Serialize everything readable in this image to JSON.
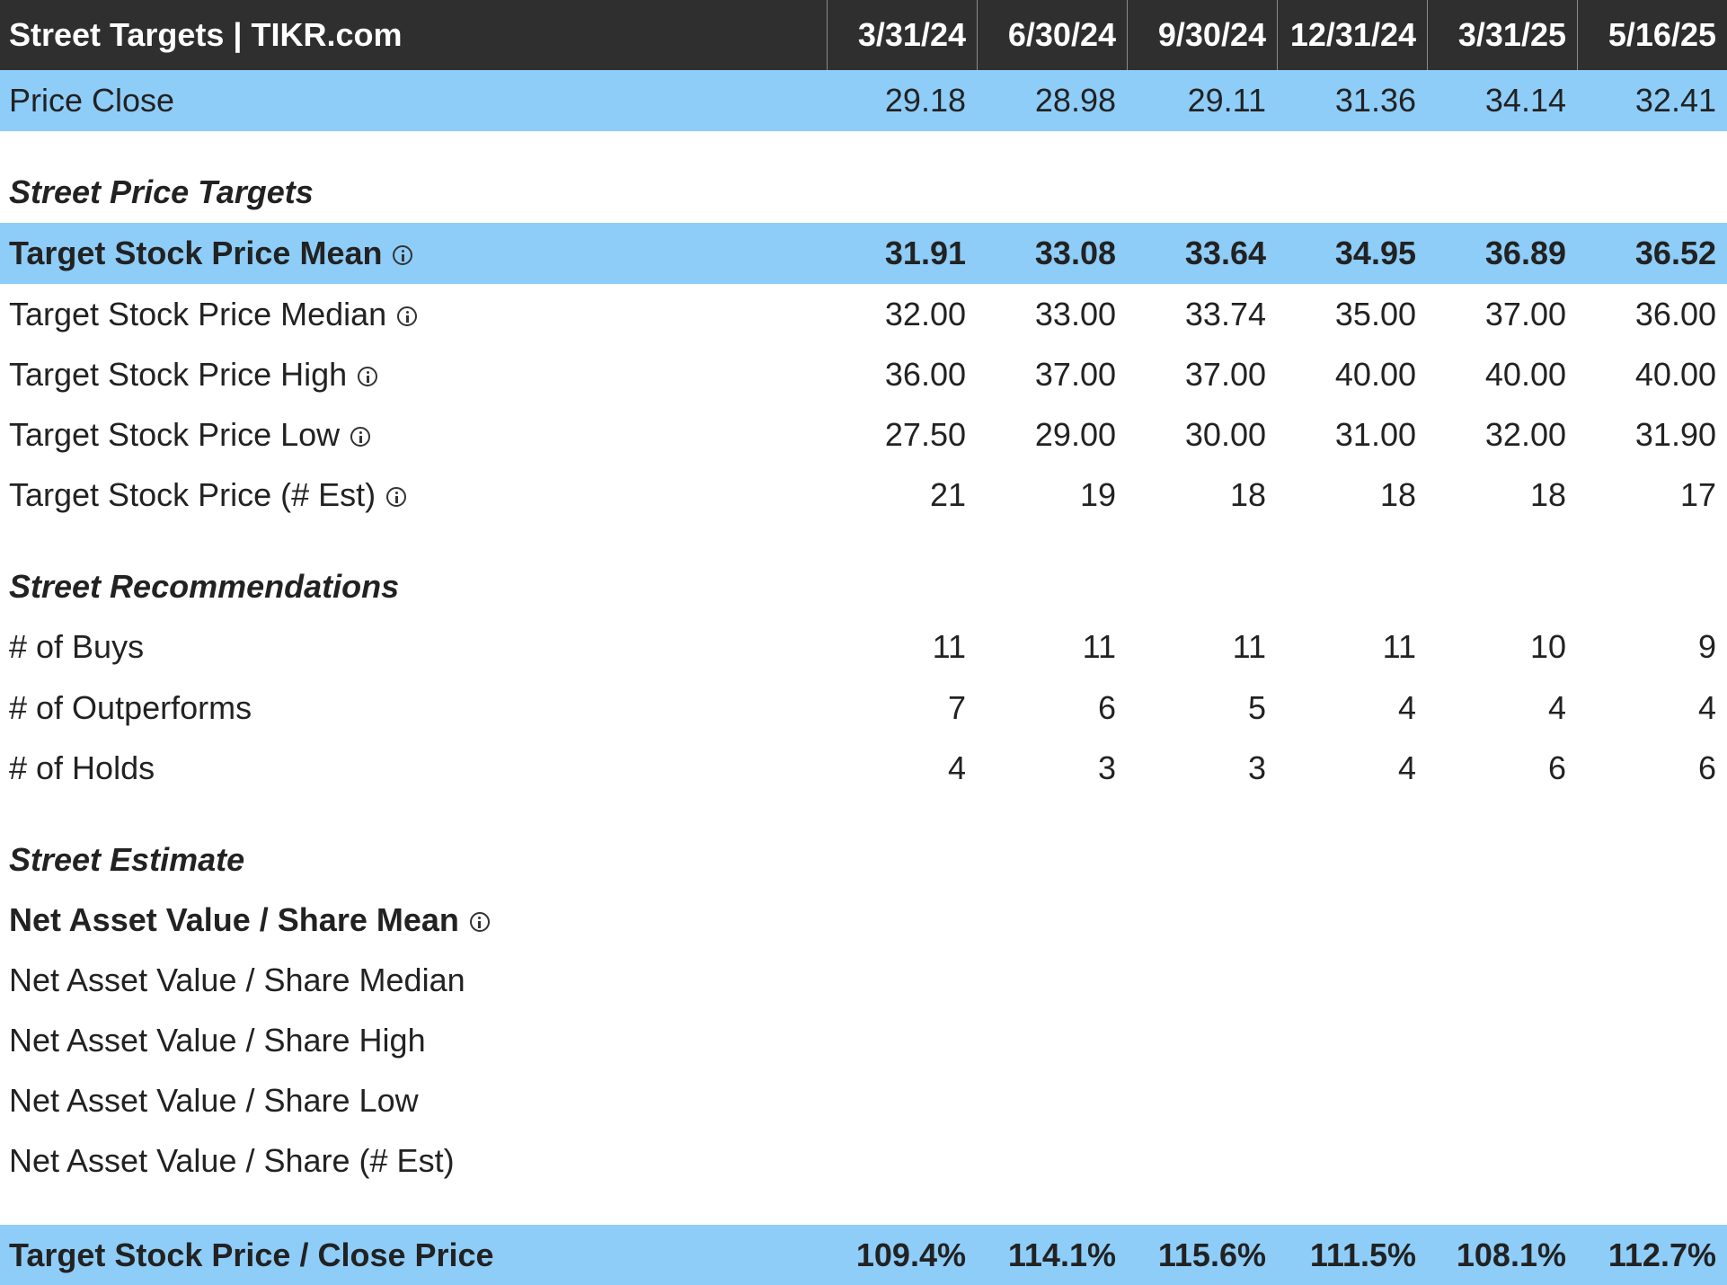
{
  "header": {
    "title": "Street Targets | TIKR.com",
    "dates": [
      "3/31/24",
      "6/30/24",
      "9/30/24",
      "12/31/24",
      "3/31/25",
      "5/16/25"
    ]
  },
  "price_close": {
    "label": "Price Close",
    "values": [
      "29.18",
      "28.98",
      "29.11",
      "31.36",
      "34.14",
      "32.41"
    ]
  },
  "sections": {
    "price_targets": "Street Price Targets",
    "recommendations": "Street Recommendations",
    "estimate": "Street Estimate"
  },
  "target_mean": {
    "label": "Target Stock Price Mean",
    "values": [
      "31.91",
      "33.08",
      "33.64",
      "34.95",
      "36.89",
      "36.52"
    ]
  },
  "target_median": {
    "label": "Target Stock Price Median",
    "values": [
      "32.00",
      "33.00",
      "33.74",
      "35.00",
      "37.00",
      "36.00"
    ]
  },
  "target_high": {
    "label": "Target Stock Price High",
    "values": [
      "36.00",
      "37.00",
      "37.00",
      "40.00",
      "40.00",
      "40.00"
    ]
  },
  "target_low": {
    "label": "Target Stock Price Low",
    "values": [
      "27.50",
      "29.00",
      "30.00",
      "31.00",
      "32.00",
      "31.90"
    ]
  },
  "target_est": {
    "label": "Target Stock Price (# Est)",
    "values": [
      "21",
      "19",
      "18",
      "18",
      "18",
      "17"
    ]
  },
  "buys": {
    "label": "# of Buys",
    "values": [
      "11",
      "11",
      "11",
      "11",
      "10",
      "9"
    ]
  },
  "outperforms": {
    "label": "# of Outperforms",
    "values": [
      "7",
      "6",
      "5",
      "4",
      "4",
      "4"
    ]
  },
  "holds": {
    "label": "# of Holds",
    "values": [
      "4",
      "3",
      "3",
      "4",
      "6",
      "6"
    ]
  },
  "nav_mean": {
    "label": "Net Asset Value / Share Mean"
  },
  "nav_median": {
    "label": "Net Asset Value / Share Median"
  },
  "nav_high": {
    "label": "Net Asset Value / Share High"
  },
  "nav_low": {
    "label": "Net Asset Value / Share Low"
  },
  "nav_est": {
    "label": "Net Asset Value / Share (# Est)"
  },
  "target_close": {
    "label": "Target Stock Price / Close Price",
    "values": [
      "109.4%",
      "114.1%",
      "115.6%",
      "111.5%",
      "108.1%",
      "112.7%"
    ]
  },
  "colors": {
    "header_bg": "#2f2f2f",
    "highlight_bg": "#8ecdf8"
  },
  "icons": {
    "info": "info-circle-icon"
  }
}
